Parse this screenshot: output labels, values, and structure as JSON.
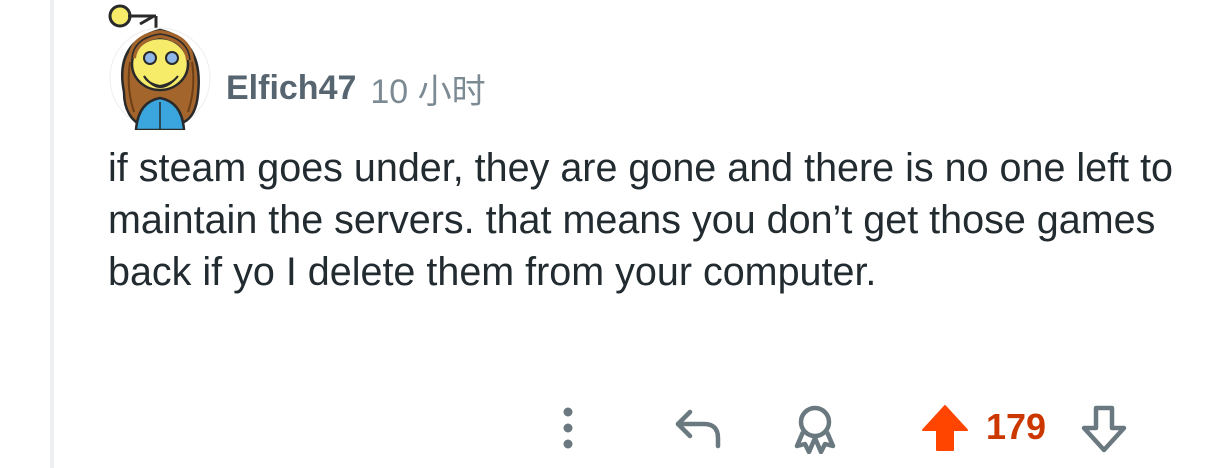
{
  "comment": {
    "author": "Elfich47",
    "timestamp": "10 小时",
    "body": "if steam goes under, they are gone and there is no one left to maintain the servers. that means you don’t get those games back if yo I delete them from your computer.",
    "score": "179"
  },
  "actions": {
    "more_icon": "vertical-dots-icon",
    "reply_icon": "reply-arrow-icon",
    "award_icon": "award-icon",
    "upvote_icon": "upvote-arrow-icon",
    "downvote_icon": "downvote-arrow-icon"
  },
  "colors": {
    "upvote_active": "#ff4500",
    "score": "#cc3700",
    "author": "#56656f",
    "body_text": "#222b30",
    "icon_gray": "#6a7880"
  }
}
